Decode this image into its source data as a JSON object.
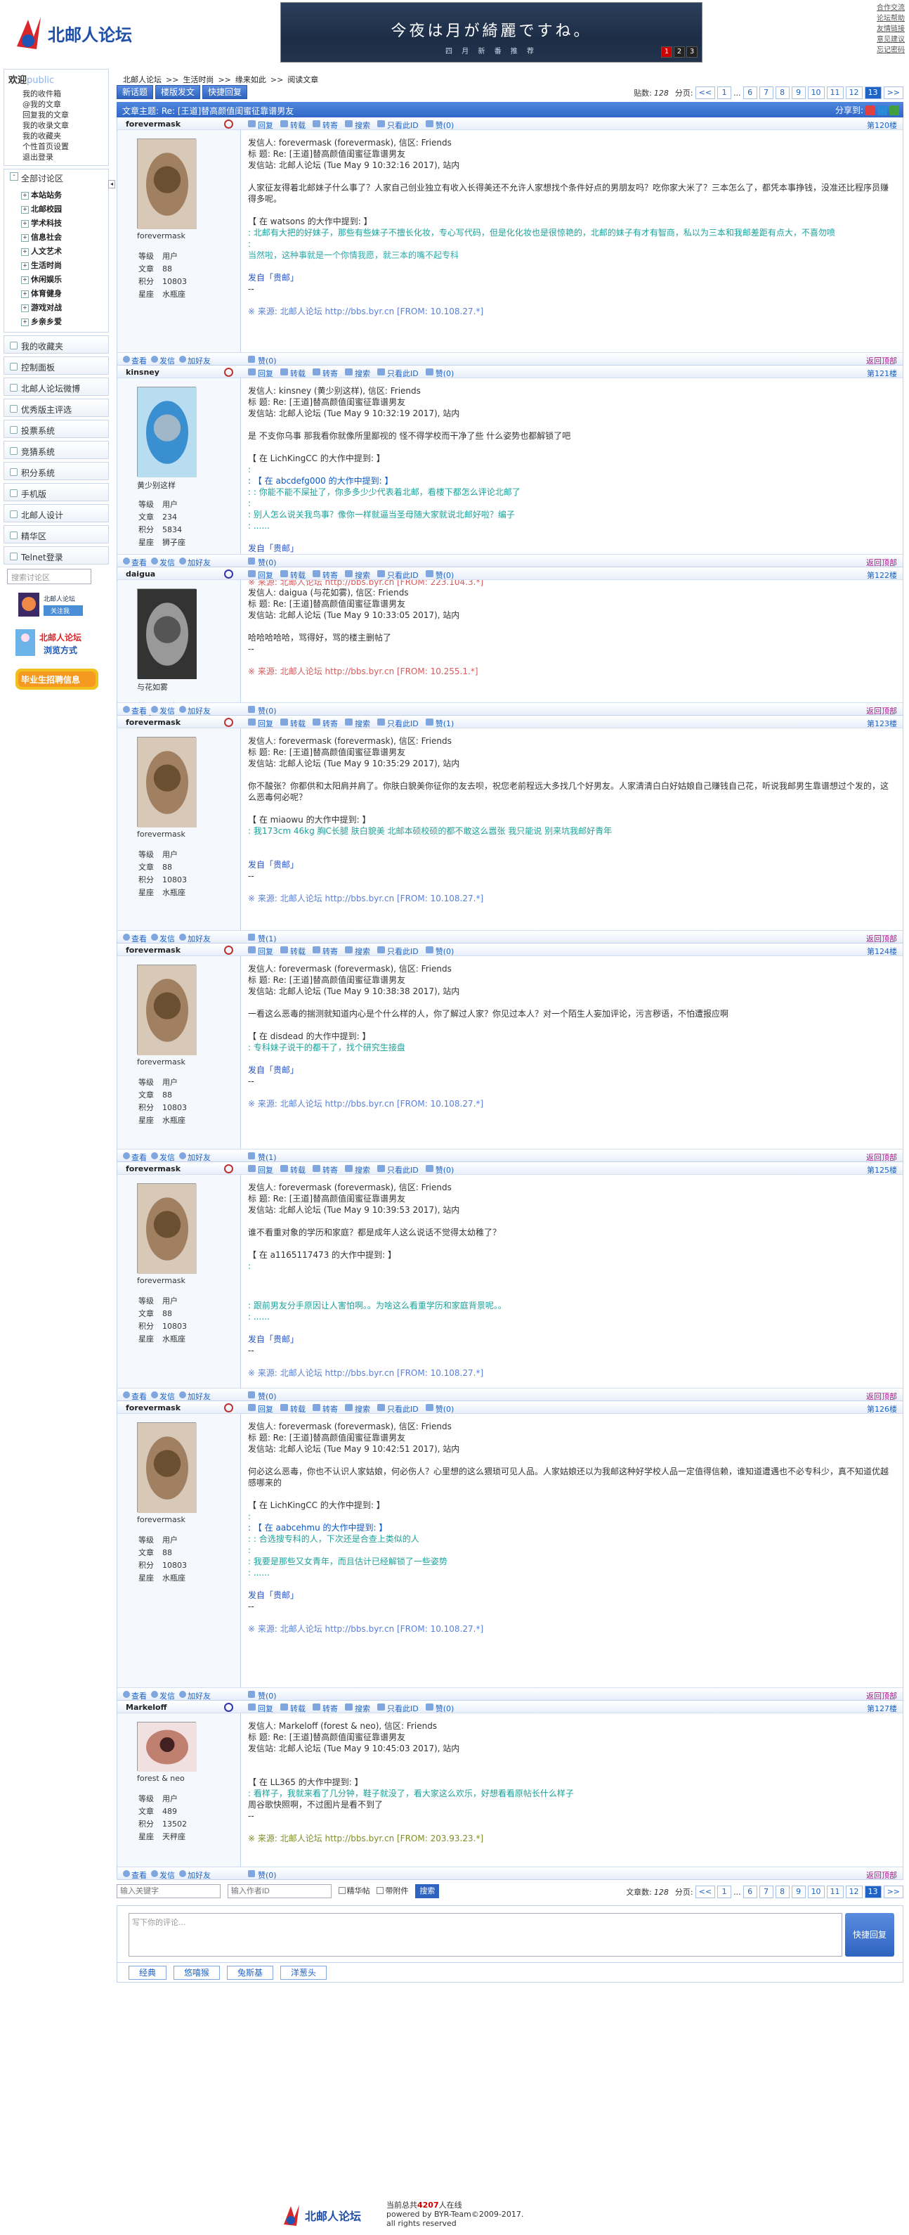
{
  "header": {
    "logo_text": "北邮人论坛",
    "banner_title": "今夜は月が綺麗ですね。",
    "banner_sub": "四 月 新 番 推 荐",
    "banner_pages": [
      "1",
      "2",
      "3"
    ],
    "top_links": [
      "合作交流",
      "论坛帮助",
      "友情链接",
      "意见建议",
      "忘记密码"
    ]
  },
  "sidebar": {
    "welcome": "欢迎",
    "user": "public",
    "my_items": [
      "我的收件箱",
      "@我的文章",
      "回复我的文章",
      "我的收录文章",
      "我的收藏夹",
      "个性首页设置",
      "退出登录"
    ],
    "all_boards": "全部讨论区",
    "boards": [
      "本站站务",
      "北邮校园",
      "学术科技",
      "信息社会",
      "人文艺术",
      "生活时尚",
      "休闲娱乐",
      "体育健身",
      "游戏对战",
      "乡亲乡爱"
    ],
    "bars": [
      "我的收藏夹",
      "控制面板",
      "北邮人论坛微博",
      "优秀版主评选",
      "投票系统",
      "竞猜系统",
      "积分系统",
      "手机版",
      "北邮人设计",
      "精华区",
      "Telnet登录"
    ],
    "search_placeholder": "搜索讨论区",
    "ad1": "北邮人论坛",
    "ad1b": "关注我",
    "ad2": "北邮人论坛",
    "ad2b": "浏览方式",
    "ad3": "毕业生招聘信息"
  },
  "crumb": [
    "北邮人论坛",
    ">>",
    "生活时尚",
    ">>",
    "缘来如此",
    ">>",
    "阅读文章"
  ],
  "toolbar": {
    "new": "新话题",
    "board": "楼版发文",
    "quick": "快捷回复",
    "count_label": "贴数:",
    "count": "128",
    "page_label": "分页:"
  },
  "pages": [
    "<<",
    "1",
    "...",
    "6",
    "7",
    "8",
    "9",
    "10",
    "11",
    "12",
    "13",
    ">>"
  ],
  "title": "文章主题: Re: [王道]替高颜值闺蜜征靠谱男友",
  "share_label": "分享到:",
  "actions": [
    "回复",
    "转载",
    "转寄",
    "搜索",
    "只看此ID",
    "赞"
  ],
  "foot_actions": [
    "查看",
    "发信",
    "加好友"
  ],
  "totop": "返回顶部",
  "posts": [
    {
      "uid": "forevermask",
      "floor": "第120楼",
      "nick": "forevermask",
      "meta": [
        [
          "等级",
          "用户"
        ],
        [
          "文章",
          "88"
        ],
        [
          "积分",
          "10803"
        ],
        [
          "星座",
          "水瓶座"
        ]
      ],
      "zan": "赞(0)",
      "flike": "赞(0)",
      "lines": [
        [
          "",
          "发信人: forevermask (forevermask), 信区: Friends"
        ],
        [
          "",
          "标  题: Re: [王道]替高颜值闺蜜征靠谱男友"
        ],
        [
          "",
          "发信站: 北邮人论坛 (Tue May  9 10:32:16 2017), 站内"
        ],
        [
          "",
          ""
        ],
        [
          "",
          "人家征友得着北邮妹子什么事了？人家自己创业独立有收入长得美还不允许人家想找个条件好点的男朋友吗？吃你家大米了？三本怎么了，都凭本事挣钱，没准还比程序员赚得多呢。"
        ],
        [
          "",
          ""
        ],
        [
          "",
          "【 在 watsons 的大作中提到: 】"
        ],
        [
          "q",
          ": 北邮有大把的好妹子，那些有些妹子不擅长化妆，专心写代码，但是化化妆也是很惊艳的，北邮的妹子有才有智商，私以为三本和我邮差距有点大，不喜勿喷"
        ],
        [
          "q",
          ":"
        ],
        [
          "ql",
          "当然啦，这种事就是一个你情我愿，就三本的嘴不起专科"
        ],
        [
          "",
          ""
        ],
        [
          "fb",
          "发自「贵邮」"
        ],
        [
          "",
          "--"
        ],
        [
          "",
          ""
        ],
        [
          "src",
          "※ 来源: 北邮人论坛 http://bbs.byr.cn [FROM: 10.108.27.*]"
        ]
      ]
    },
    {
      "uid": "kinsney",
      "floor": "第121楼",
      "nick": "黄少别这样",
      "meta": [
        [
          "等级",
          "用户"
        ],
        [
          "文章",
          "234"
        ],
        [
          "积分",
          "5834"
        ],
        [
          "星座",
          "狮子座"
        ]
      ],
      "zan": "赞(0)",
      "flike": "赞(0)",
      "lines": [
        [
          "",
          "发信人: kinsney (黄少别这样), 信区: Friends"
        ],
        [
          "",
          "标  题: Re: [王道]替高颜值闺蜜征靠谱男友"
        ],
        [
          "",
          "发信站: 北邮人论坛 (Tue May  9 10:32:19 2017), 站内"
        ],
        [
          "",
          ""
        ],
        [
          "",
          "是 不支你乌事 那我看你就像所里鄙视的 怪不得学校而干净了些 什么姿势也都解锁了吧"
        ],
        [
          "",
          ""
        ],
        [
          "",
          "【 在 LichKingCC 的大作中提到: 】"
        ],
        [
          "q",
          ":"
        ],
        [
          "qb",
          ": 【 在 abcdefg000 的大作中提到: 】"
        ],
        [
          "q",
          ": : 你能不能不屎扯了，你多多少少代表着北邮，看楼下都怎么评论北邮了"
        ],
        [
          "q",
          ":"
        ],
        [
          "q",
          ": 别人怎么说关我鸟事？像你一样就逼当圣母随大家就说北邮好啦？编子"
        ],
        [
          "q",
          ": ......"
        ],
        [
          "",
          ""
        ],
        [
          "fb",
          "发自「贵邮」"
        ],
        [
          "",
          "--"
        ],
        [
          "",
          ""
        ],
        [
          "src2",
          "※ 来源: 北邮人论坛 http://bbs.byr.cn [FROM: 223.104.3.*]"
        ]
      ]
    },
    {
      "uid": "daigua",
      "floor": "第122楼",
      "nick": "与花如雾",
      "meta": [
        [
          "等级",
          "用户"
        ],
        [
          "文章",
          "279"
        ],
        [
          "积分",
          "5252"
        ],
        [
          "星座",
          "狮子座"
        ]
      ],
      "zan": "赞(0)",
      "flike": "赞(0)",
      "lines": [
        [
          "",
          "发信人: daigua (与花如雾), 信区: Friends"
        ],
        [
          "",
          "标  题: Re: [王道]替高颜值闺蜜征靠谱男友"
        ],
        [
          "",
          "发信站: 北邮人论坛 (Tue May  9 10:33:05 2017), 站内"
        ],
        [
          "",
          ""
        ],
        [
          "",
          "哈哈哈哈哈，骂得好，骂的楼主删帖了"
        ],
        [
          "",
          "--"
        ],
        [
          "",
          ""
        ],
        [
          "src2",
          "※ 来源: 北邮人论坛 http://bbs.byr.cn [FROM: 10.255.1.*]"
        ]
      ]
    },
    {
      "uid": "forevermask",
      "floor": "第123楼",
      "nick": "forevermask",
      "meta": [
        [
          "等级",
          "用户"
        ],
        [
          "文章",
          "88"
        ],
        [
          "积分",
          "10803"
        ],
        [
          "星座",
          "水瓶座"
        ]
      ],
      "zan": "赞(1)",
      "flike": "赞(1)",
      "lines": [
        [
          "",
          "发信人: forevermask (forevermask), 信区: Friends"
        ],
        [
          "",
          "标  题: Re: [王道]替高颜值闺蜜征靠谱男友"
        ],
        [
          "",
          "发信站: 北邮人论坛 (Tue May  9 10:35:29 2017), 站内"
        ],
        [
          "",
          ""
        ],
        [
          "",
          "你不酸张？你都供和太阳肩并肩了。你肤白貌美你征你的友去呗，祝您老前程远大多找几个好男友。人家清清白白好姑娘自己赚钱自己花，听说我邮男生靠谱想过个发的，这么恶毒何必呢？"
        ],
        [
          "",
          ""
        ],
        [
          "",
          "【 在 miaowu 的大作中提到: 】"
        ],
        [
          "q",
          ": 我173cm 46kg 胸C长腿 肤白貌美 北邮本硕校硕的都不敢这么嚣张 我只能说 别来坑我邮好青年"
        ],
        [
          "",
          ""
        ],
        [
          "",
          ""
        ],
        [
          "fb",
          "发自「贵邮」"
        ],
        [
          "",
          "--"
        ],
        [
          "",
          ""
        ],
        [
          "src",
          "※ 来源: 北邮人论坛 http://bbs.byr.cn [FROM: 10.108.27.*]"
        ]
      ]
    },
    {
      "uid": "forevermask",
      "floor": "第124楼",
      "nick": "forevermask",
      "meta": [
        [
          "等级",
          "用户"
        ],
        [
          "文章",
          "88"
        ],
        [
          "积分",
          "10803"
        ],
        [
          "星座",
          "水瓶座"
        ]
      ],
      "zan": "赞(0)",
      "flike": "赞(1)",
      "lines": [
        [
          "",
          "发信人: forevermask (forevermask), 信区: Friends"
        ],
        [
          "",
          "标  题: Re: [王道]替高颜值闺蜜征靠谱男友"
        ],
        [
          "",
          "发信站: 北邮人论坛 (Tue May  9 10:38:38 2017), 站内"
        ],
        [
          "",
          ""
        ],
        [
          "",
          "一看这么恶毒的揣测就知道内心是个什么样的人，你了解过人家？你见过本人？对一个陌生人妄加评论，污言秽语，不怕遭报应啊"
        ],
        [
          "",
          ""
        ],
        [
          "",
          "【 在 disdead 的大作中提到: 】"
        ],
        [
          "q",
          ": 专科妹子说干的都干了，找个研究生接盘"
        ],
        [
          "",
          ""
        ],
        [
          "fb",
          "发自「贵邮」"
        ],
        [
          "",
          "--"
        ],
        [
          "",
          ""
        ],
        [
          "src",
          "※ 来源: 北邮人论坛 http://bbs.byr.cn [FROM: 10.108.27.*]"
        ]
      ]
    },
    {
      "uid": "forevermask",
      "floor": "第125楼",
      "nick": "forevermask",
      "meta": [
        [
          "等级",
          "用户"
        ],
        [
          "文章",
          "88"
        ],
        [
          "积分",
          "10803"
        ],
        [
          "星座",
          "水瓶座"
        ]
      ],
      "zan": "赞(0)",
      "flike": "赞(0)",
      "lines": [
        [
          "",
          "发信人: forevermask (forevermask), 信区: Friends"
        ],
        [
          "",
          "标  题: Re: [王道]替高颜值闺蜜征靠谱男友"
        ],
        [
          "",
          "发信站: 北邮人论坛 (Tue May  9 10:39:53 2017), 站内"
        ],
        [
          "",
          ""
        ],
        [
          "",
          "谁不看重对象的学历和家庭？都是成年人这么说话不觉得太幼稚了？"
        ],
        [
          "",
          ""
        ],
        [
          "",
          "【 在 a1165117473 的大作中提到: 】"
        ],
        [
          "q",
          ":"
        ],
        [
          "",
          ""
        ],
        [
          "q",
          ": 跟前男友分手原因让人害怕啊。。为啥这么看重学历和家庭背景呢。。"
        ],
        [
          "q",
          ": ......"
        ],
        [
          "",
          ""
        ],
        [
          "fb",
          "发自「贵邮」"
        ],
        [
          "",
          "--"
        ],
        [
          "",
          ""
        ],
        [
          "src",
          "※ 来源: 北邮人论坛 http://bbs.byr.cn [FROM: 10.108.27.*]"
        ]
      ]
    },
    {
      "uid": "forevermask",
      "floor": "第126楼",
      "nick": "forevermask",
      "meta": [
        [
          "等级",
          "用户"
        ],
        [
          "文章",
          "88"
        ],
        [
          "积分",
          "10803"
        ],
        [
          "星座",
          "水瓶座"
        ]
      ],
      "zan": "赞(0)",
      "flike": "赞(0)",
      "lines": [
        [
          "",
          "发信人: forevermask (forevermask), 信区: Friends"
        ],
        [
          "",
          "标  题: Re: [王道]替高颜值闺蜜征靠谱男友"
        ],
        [
          "",
          "发信站: 北邮人论坛 (Tue May  9 10:42:51 2017), 站内"
        ],
        [
          "",
          ""
        ],
        [
          "",
          "何必这么恶毒，你也不认识人家姑娘，何必伤人？心里想的这么猥琐可见人品。人家姑娘还以为我邮这种好学校人品一定值得信赖，谁知道遭遇也不必专科少，真不知道优越感哪来的"
        ],
        [
          "",
          ""
        ],
        [
          "",
          "【 在 LichKingCC 的大作中提到: 】"
        ],
        [
          "q",
          ":"
        ],
        [
          "qb",
          ": 【 在 aabcehmu 的大作中提到: 】"
        ],
        [
          "q",
          ": : 合选搜专科的人，下次还是合查上类似的人"
        ],
        [
          "q",
          ":"
        ],
        [
          "q",
          ": 我要是那些又女青年，而且估计已经解锁了一些姿势"
        ],
        [
          "q",
          ": ......"
        ],
        [
          "",
          ""
        ],
        [
          "fb",
          "发自「贵邮」"
        ],
        [
          "",
          "--"
        ],
        [
          "",
          ""
        ],
        [
          "src",
          "※ 来源: 北邮人论坛 http://bbs.byr.cn [FROM: 10.108.27.*]"
        ]
      ]
    },
    {
      "uid": "Markeloff",
      "floor": "第127楼",
      "nick": "forest & neo",
      "meta": [
        [
          "等级",
          "用户"
        ],
        [
          "文章",
          "489"
        ],
        [
          "积分",
          "13502"
        ],
        [
          "星座",
          "天秤座"
        ]
      ],
      "zan": "赞(0)",
      "flike": "赞(0)",
      "lines": [
        [
          "",
          "发信人: Markeloff (forest & neo), 信区: Friends"
        ],
        [
          "",
          "标  题: Re: [王道]替高颜值闺蜜征靠谱男友"
        ],
        [
          "",
          "发信站: 北邮人论坛 (Tue May  9 10:45:03 2017), 站内"
        ],
        [
          "",
          ""
        ],
        [
          "",
          ""
        ],
        [
          "",
          "【 在 LL365 的大作中提到: 】"
        ],
        [
          "q",
          ": 看样子，我就来看了几分钟，鞋子就没了，看大家这么欢乐，好想看看原帖长什么样子"
        ],
        [
          "",
          "周谷歌快照啊，不过图片是看不到了"
        ],
        [
          "",
          "--"
        ],
        [
          "",
          ""
        ],
        [
          "src3",
          "※ 来源: 北邮人论坛 http://bbs.byr.cn [FROM: 203.93.23.*]"
        ]
      ]
    }
  ],
  "bottom": {
    "kw_placeholder": "输入关键字",
    "author_placeholder": "输入作者ID",
    "chk1": "精华帖",
    "chk2": "带附件",
    "search": "搜索",
    "count_label": "文章数:",
    "count": "128",
    "page_label": "分页:"
  },
  "reply": {
    "placeholder": "写下你的评论...",
    "button": "快捷回复"
  },
  "tabs": [
    "经典",
    "悠嘻猴",
    "兔斯基",
    "洋葱头"
  ],
  "footer": {
    "online_pre": "当前总共",
    "online": "4207",
    "online_post": "人在线",
    "powered": "powered by BYR-Team©2009-2017.",
    "rights": "all rights reserved"
  }
}
